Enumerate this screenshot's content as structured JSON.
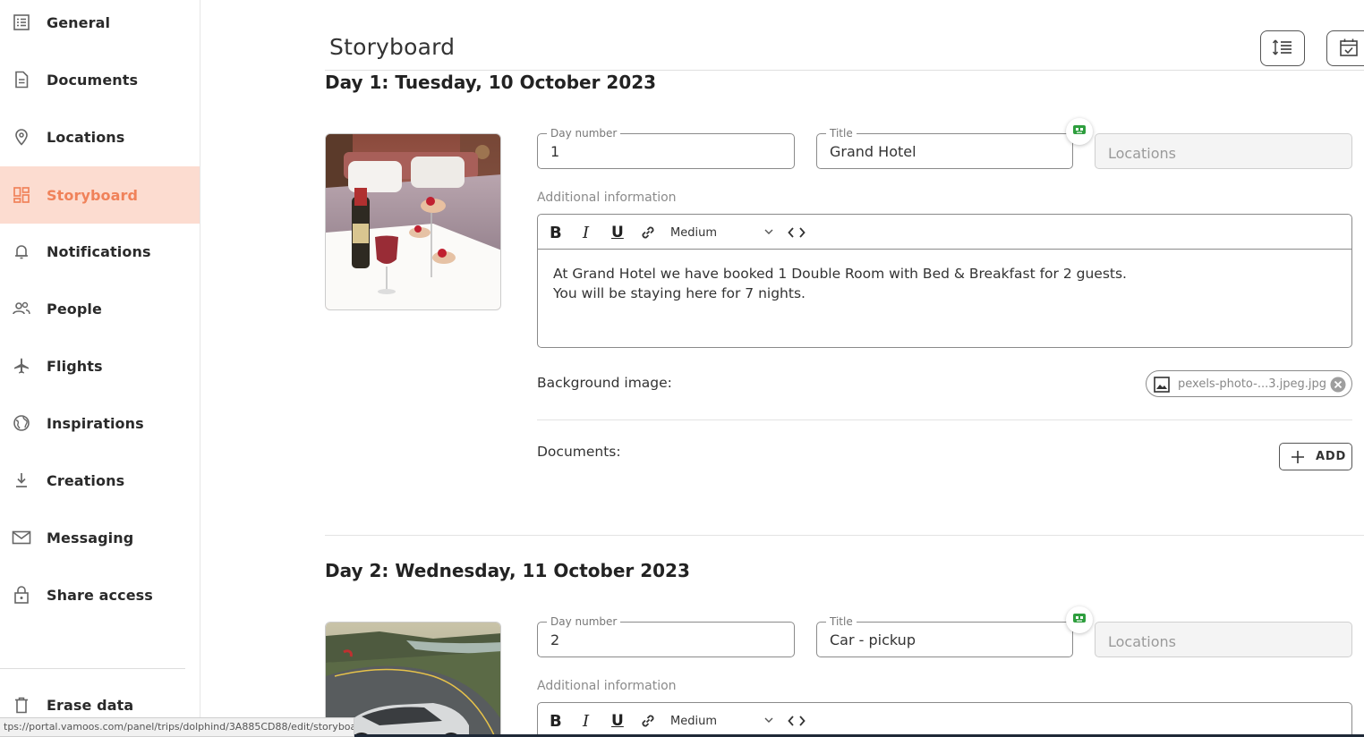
{
  "sidebar": {
    "items": [
      {
        "label": "General",
        "icon": "list-icon"
      },
      {
        "label": "Documents",
        "icon": "document-icon"
      },
      {
        "label": "Locations",
        "icon": "location-pin-icon"
      },
      {
        "label": "Storyboard",
        "icon": "dashboard-icon",
        "active": true
      },
      {
        "label": "Notifications",
        "icon": "bell-icon"
      },
      {
        "label": "People",
        "icon": "people-icon"
      },
      {
        "label": "Flights",
        "icon": "airplane-icon"
      },
      {
        "label": "Inspirations",
        "icon": "globe-icon"
      },
      {
        "label": "Creations",
        "icon": "download-icon"
      },
      {
        "label": "Messaging",
        "icon": "mail-icon"
      },
      {
        "label": "Share access",
        "icon": "lock-icon"
      }
    ],
    "erase": {
      "label": "Erase data",
      "icon": "trash-icon"
    }
  },
  "header": {
    "title": "Storyboard",
    "buttons": [
      "line-spacing-icon",
      "calendar-check-icon"
    ]
  },
  "days": [
    {
      "heading_prefix": "Day 1:",
      "heading_date": "Tuesday, 10 October 2023",
      "image": "hotel-room-champagne-photo",
      "day_number_label": "Day number",
      "day_number": "1",
      "title_label": "Title",
      "title": "Grand Hotel",
      "locations_placeholder": "Locations",
      "additional_label": "Additional information",
      "toolbar": {
        "bold": "B",
        "italic": "I",
        "underline": "U",
        "size": "Medium"
      },
      "text_line1": "At Grand Hotel we have booked 1 Double Room with Bed & Breakfast for 2 guests.",
      "text_line2": "You will be staying here for 7 nights.",
      "background_label": "Background image:",
      "background_file": "pexels-photo-...3.jpeg.jpg",
      "documents_label": "Documents:",
      "add_label": "ADD"
    },
    {
      "heading_prefix": "Day 2:",
      "heading_date": "Wednesday, 11 October 2023",
      "image": "convertible-car-road-photo",
      "day_number_label": "Day number",
      "day_number": "2",
      "title_label": "Title",
      "title": "Car - pickup",
      "locations_placeholder": "Locations",
      "additional_label": "Additional information",
      "toolbar": {
        "bold": "B",
        "italic": "I",
        "underline": "U",
        "size": "Medium"
      }
    }
  ],
  "status_url": "tps://portal.vamoos.com/panel/trips/dolphind/3A885CD88/edit/storyboard",
  "colors": {
    "accent": "#f0825a",
    "active_bg": "#fcdcd0",
    "ai_green": "#2e9e3e"
  }
}
